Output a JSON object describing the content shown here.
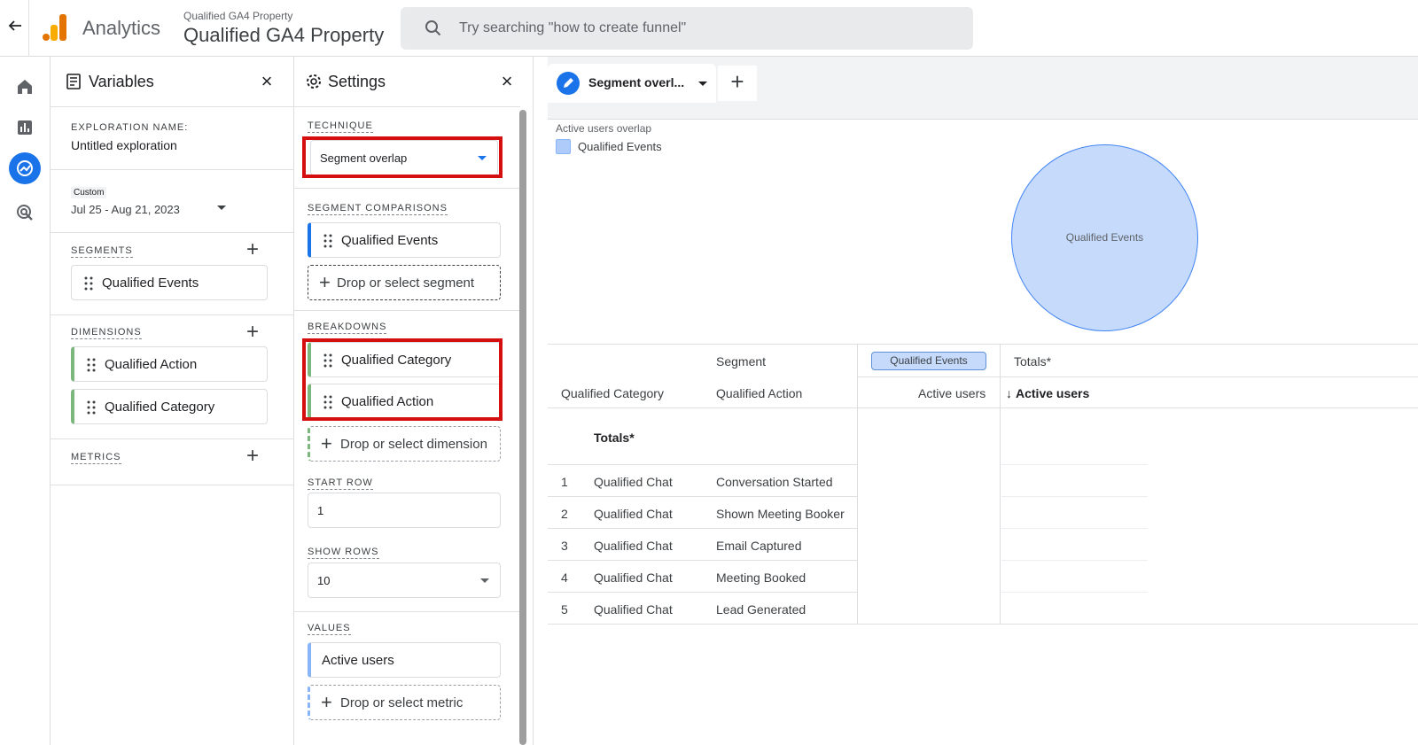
{
  "header": {
    "app_name": "Analytics",
    "property_small": "Qualified GA4 Property",
    "property_big": "Qualified GA4 Property",
    "search_placeholder": "Try searching \"how to create funnel\""
  },
  "rail": {
    "items": [
      "home-icon",
      "reports-icon",
      "explore-icon",
      "advertising-icon"
    ],
    "active_index": 2
  },
  "variables": {
    "title": "Variables",
    "exploration_label": "EXPLORATION NAME:",
    "exploration_name": "Untitled exploration",
    "date_badge": "Custom",
    "date_range": "Jul 25 - Aug 21, 2023",
    "segments_label": "SEGMENTS",
    "segments": [
      "Qualified Events"
    ],
    "dimensions_label": "DIMENSIONS",
    "dimensions": [
      "Qualified Action",
      "Qualified Category"
    ],
    "metrics_label": "METRICS"
  },
  "settings": {
    "title": "Settings",
    "technique_label": "TECHNIQUE",
    "technique_value": "Segment overlap",
    "segment_comparisons_label": "SEGMENT COMPARISONS",
    "segment_comparisons": [
      "Qualified Events"
    ],
    "drop_segment": "Drop or select segment",
    "breakdowns_label": "BREAKDOWNS",
    "breakdowns": [
      "Qualified Category",
      "Qualified Action"
    ],
    "drop_dimension": "Drop or select dimension",
    "start_row_label": "START ROW",
    "start_row_value": "1",
    "show_rows_label": "SHOW ROWS",
    "show_rows_value": "10",
    "values_label": "VALUES",
    "values": [
      "Active users"
    ],
    "drop_metric": "Drop or select metric"
  },
  "canvas": {
    "tab_label": "Segment overl...",
    "viz_title": "Active users overlap",
    "legend": "Qualified Events",
    "venn_label": "Qualified Events",
    "colors": {
      "segment_fill": "#c6dafc",
      "segment_stroke": "#4285f4",
      "accent": "#1a73e8",
      "highlight": "#d50f0f"
    }
  },
  "table": {
    "segment_header": "Segment",
    "segment_chip": "Qualified Events",
    "totals_header": "Totals*",
    "col_category": "Qualified Category",
    "col_action": "Qualified Action",
    "col_active_users": "Active users",
    "col_active_users_sorted": "Active users",
    "sort_arrow": "↓",
    "totals_row": "Totals*",
    "rows": [
      {
        "n": "1",
        "category": "Qualified Chat",
        "action": "Conversation Started"
      },
      {
        "n": "2",
        "category": "Qualified Chat",
        "action": "Shown Meeting Booker"
      },
      {
        "n": "3",
        "category": "Qualified Chat",
        "action": "Email Captured"
      },
      {
        "n": "4",
        "category": "Qualified Chat",
        "action": "Meeting Booked"
      },
      {
        "n": "5",
        "category": "Qualified Chat",
        "action": "Lead Generated"
      }
    ]
  }
}
